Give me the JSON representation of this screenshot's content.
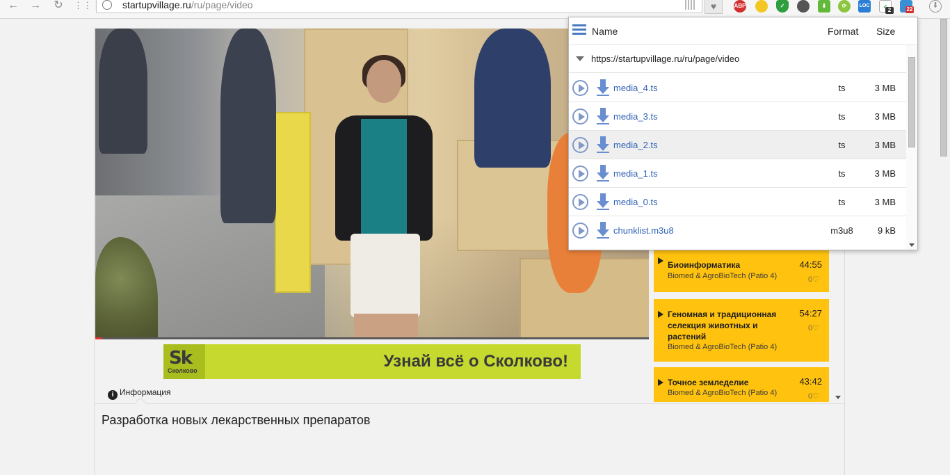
{
  "browser": {
    "url_host": "startupvillage.ru",
    "url_path": "/ru/page/video",
    "ext_badges": [
      "2",
      "22"
    ],
    "abp_label": "ABP",
    "loc_label": "LOC"
  },
  "banner": {
    "logo": "Sk",
    "logo_sub": "Сколково",
    "slogan": "Узнай всё о Сколково!"
  },
  "info": {
    "tab_label": "Информация",
    "title": "Разработка новых лекарственных препаратов"
  },
  "playlist": [
    {
      "title": "Биоинформатика",
      "duration": "44:55",
      "subtitle": "Biomed & AgroBioTech (Patio 4)",
      "likes": "0♡"
    },
    {
      "title": "Геномная и традиционная селекция животных и растений",
      "duration": "54:27",
      "subtitle": "Biomed & AgroBioTech (Patio 4)",
      "likes": "0♡"
    },
    {
      "title": "Точное земледелие",
      "duration": "43:42",
      "subtitle": "Biomed & AgroBioTech (Patio 4)",
      "likes": "0♡"
    }
  ],
  "popup": {
    "columns": {
      "name": "Name",
      "format": "Format",
      "size": "Size"
    },
    "page_url": "https://startupvillage.ru/ru/page/video",
    "files": [
      {
        "name": "media_4.ts",
        "format": "ts",
        "size": "3 MB"
      },
      {
        "name": "media_3.ts",
        "format": "ts",
        "size": "3 MB"
      },
      {
        "name": "media_2.ts",
        "format": "ts",
        "size": "3 MB"
      },
      {
        "name": "media_1.ts",
        "format": "ts",
        "size": "3 MB"
      },
      {
        "name": "media_0.ts",
        "format": "ts",
        "size": "3 MB"
      },
      {
        "name": "chunklist.m3u8",
        "format": "m3u8",
        "size": "9 kB"
      }
    ]
  },
  "colors": {
    "accent_yellow": "#ffc20e",
    "banner_green": "#c5d92e",
    "link_blue": "#2f62b5"
  }
}
